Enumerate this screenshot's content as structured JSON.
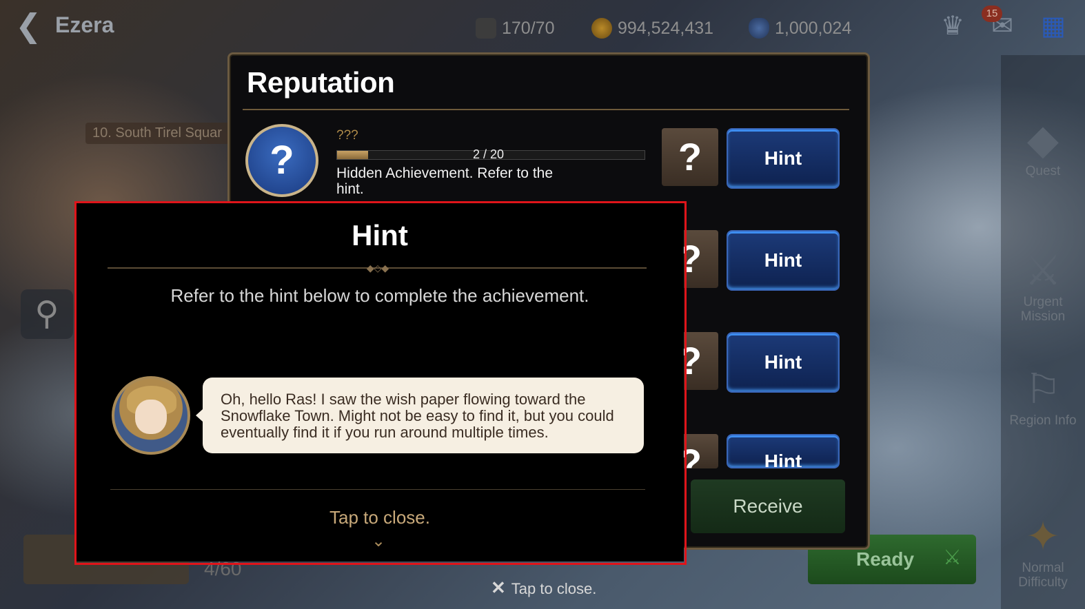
{
  "topbar": {
    "region_name": "Ezera",
    "stamina": "170",
    "stamina_max": "/70",
    "gold": "994,524,431",
    "crystals": "1,000,024",
    "mail_count": "15"
  },
  "map": {
    "location_label": "10. South Tirel Squar",
    "bottom_left_count": "4/60",
    "bottom_ready": "Ready"
  },
  "sidebar": {
    "items": [
      {
        "label": "Quest",
        "icon": "quest-icon"
      },
      {
        "label": "Urgent Mission",
        "icon": "urgent-mission-icon"
      },
      {
        "label": "Region Info",
        "icon": "region-info-icon"
      },
      {
        "label": "Normal Difficulty",
        "icon": "difficulty-icon"
      }
    ]
  },
  "reputation": {
    "title": "Reputation",
    "achievement_name": "???",
    "progress_text": "2 / 20",
    "progress_fraction": 0.1,
    "description": "Hidden Achievement. Refer to the hint.",
    "question_mark": "?",
    "hint_labels": [
      "Hint",
      "Hint",
      "Hint",
      "Hint"
    ],
    "receive_label": "Receive",
    "tap_to_close": "Tap to close."
  },
  "hint_popup": {
    "title": "Hint",
    "instruction": "Refer to the hint below to complete the achievement.",
    "dialogue": "Oh, hello Ras! I saw the wish paper flowing toward the Snowflake Town. Might not be easy to find it, but you could eventually find it if you run around multiple times.",
    "tap_to_close": "Tap to close."
  },
  "colors": {
    "highlight_frame": "#e0141a",
    "hint_button": "#1c3a78",
    "gold_accent": "#c8a97a"
  }
}
